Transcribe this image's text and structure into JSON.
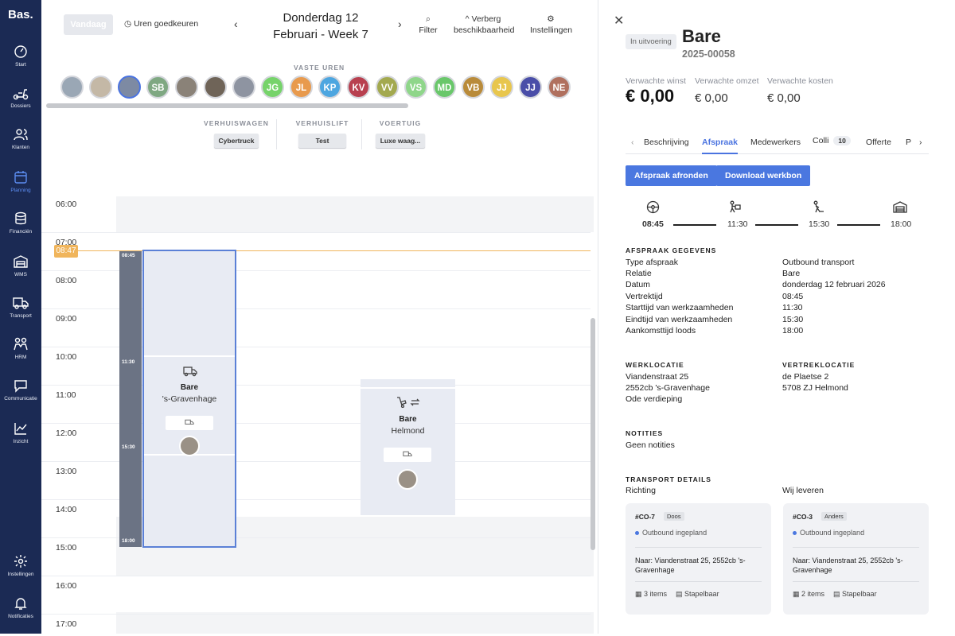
{
  "app": {
    "logo": "Bas."
  },
  "sidebar": {
    "items": [
      {
        "label": "Start",
        "icon": "dashboard-icon"
      },
      {
        "label": "Dossiers",
        "icon": "scooter-icon"
      },
      {
        "label": "Klanten",
        "icon": "users-icon"
      },
      {
        "label": "Planning",
        "icon": "calendar-icon",
        "active": true
      },
      {
        "label": "Financiën",
        "icon": "coins-icon"
      },
      {
        "label": "WMS",
        "icon": "warehouse-icon"
      },
      {
        "label": "Transport",
        "icon": "truck-icon"
      },
      {
        "label": "HRM",
        "icon": "people-icon"
      },
      {
        "label": "Communicatie",
        "icon": "chat-icon"
      },
      {
        "label": "Inzicht",
        "icon": "chart-icon"
      }
    ],
    "bottom": [
      {
        "label": "Instellingen",
        "icon": "gear-icon"
      },
      {
        "label": "Notificaties",
        "icon": "bell-icon"
      }
    ]
  },
  "toolbar": {
    "today": "Vandaag",
    "approve_hours": "Uren goedkeuren",
    "date_line1": "Donderdag 12",
    "date_line2": "Februari - Week 7",
    "filter": "Filter",
    "hide_availability_1": "Verberg",
    "hide_availability_2": "beschikbaarheid",
    "settings": "Instellingen"
  },
  "fixed_hours": {
    "label": "VASTE UREN",
    "avatars": [
      {
        "initials": "",
        "color": "#9aa7b5"
      },
      {
        "initials": "",
        "color": "#c4b8a6"
      },
      {
        "initials": "",
        "color": "#7d8aa3"
      },
      {
        "initials": "SB",
        "color": "#7fa882"
      },
      {
        "initials": "",
        "color": "#8a8278"
      },
      {
        "initials": "",
        "color": "#6f6458"
      },
      {
        "initials": "",
        "color": "#8e94a1"
      },
      {
        "initials": "JG",
        "color": "#76d36a"
      },
      {
        "initials": "JL",
        "color": "#e89a4d"
      },
      {
        "initials": "KP",
        "color": "#4da6e0"
      },
      {
        "initials": "KV",
        "color": "#b8404f"
      },
      {
        "initials": "VV",
        "color": "#a3a94f"
      },
      {
        "initials": "VS",
        "color": "#8fd68a"
      },
      {
        "initials": "MD",
        "color": "#69c76a"
      },
      {
        "initials": "VB",
        "color": "#b98b3a"
      },
      {
        "initials": "JJ",
        "color": "#e8c64d"
      },
      {
        "initials": "JJ",
        "color": "#4a4ea8"
      },
      {
        "initials": "NE",
        "color": "#b0705e"
      }
    ]
  },
  "vehicles": [
    {
      "label": "VERHUISWAGEN",
      "button": "Cybertruck"
    },
    {
      "label": "VERHUISLIFT",
      "button": "Test"
    },
    {
      "label": "VOERTUIG",
      "button": "Luxe waag..."
    }
  ],
  "timeline": {
    "hours": [
      "06:00",
      "07:00",
      "08:00",
      "09:00",
      "10:00",
      "11:00",
      "12:00",
      "13:00",
      "14:00",
      "15:00",
      "16:00",
      "17:00"
    ],
    "now": "08:47"
  },
  "appointments": [
    {
      "title": "Bare",
      "location": "'s-Gravenhage",
      "times": [
        "08:45",
        "11:30",
        "15:30",
        "18:00"
      ]
    },
    {
      "title": "Bare",
      "location": "Helmond"
    }
  ],
  "detail": {
    "status": "In uitvoering",
    "title": "Bare",
    "number": "2025-00058",
    "metrics": [
      {
        "label": "Verwachte winst",
        "value": "€ 0,00"
      },
      {
        "label": "Verwachte omzet",
        "value": "€ 0,00"
      },
      {
        "label": "Verwachte kosten",
        "value": "€ 0,00"
      }
    ],
    "tabs": [
      "Beschrijving",
      "Afspraak",
      "Medewerkers",
      "Colli",
      "Offerte",
      "P"
    ],
    "colli_count": "10",
    "actions": {
      "finish": "Afspraak afronden",
      "download": "Download werkbon"
    },
    "timeline_times": [
      "08:45",
      "11:30",
      "15:30",
      "18:00"
    ],
    "appointment_section": "AFSPRAAK GEGEVENS",
    "appointment_rows": [
      {
        "label": "Type afspraak",
        "value": "Outbound transport"
      },
      {
        "label": "Relatie",
        "value": "Bare"
      },
      {
        "label": "Datum",
        "value": "donderdag 12 februari 2026"
      },
      {
        "label": "Vertrektijd",
        "value": "08:45"
      },
      {
        "label": "Starttijd van werkzaamheden",
        "value": "11:30"
      },
      {
        "label": "Eindtijd van werkzaamheden",
        "value": "15:30"
      },
      {
        "label": "Aankomsttijd loods",
        "value": "18:00"
      }
    ],
    "work_location": {
      "title": "WERKLOCATIE",
      "lines": [
        "Viandenstraat 25",
        "2552cb 's-Gravenhage",
        "Ode verdieping"
      ]
    },
    "departure_location": {
      "title": "VERTREKLOCATIE",
      "lines": [
        "de Plaetse 2",
        "5708 ZJ Helmond"
      ]
    },
    "notes": {
      "title": "NOTITIES",
      "text": "Geen notities"
    },
    "transport": {
      "title": "TRANSPORT DETAILS",
      "direction_label": "Richting",
      "direction_value": "Wij leveren",
      "cards": [
        {
          "code": "#CO-7",
          "tag": "Doos",
          "status": "Outbound ingepland",
          "dest": "Naar: Viandenstraat 25, 2552cb 's-Gravenhage",
          "items": "3 items",
          "stack": "Stapelbaar"
        },
        {
          "code": "#CO-3",
          "tag": "Anders",
          "status": "Outbound ingepland",
          "dest": "Naar: Viandenstraat 25, 2552cb 's-Gravenhage",
          "items": "2 items",
          "stack": "Stapelbaar"
        }
      ]
    }
  }
}
